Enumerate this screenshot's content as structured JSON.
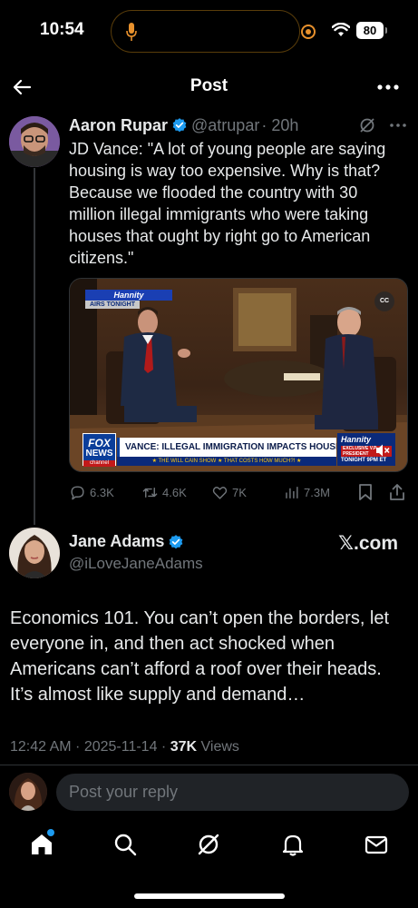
{
  "status_bar": {
    "time": "10:54",
    "battery": "80"
  },
  "header": {
    "title": "Post"
  },
  "quoted_post": {
    "author_name": "Aaron Rupar",
    "handle": "@atrupar",
    "age": "· 20h",
    "text": "JD Vance: \"A lot of young people are saying housing is way too expensive. Why is that? Because we flooded the country with 30 million illegal immigrants who were taking houses that ought by right go to American citizens.\"",
    "video": {
      "show_badge": "Hannity",
      "airs_badge": "AIRS TONIGHT",
      "cc_label": "CC",
      "network_line1": "FOX",
      "network_line2": "NEWS",
      "network_line3": "channel",
      "chyron": "VANCE: ILLEGAL IMMIGRATION IMPACTS HOUSING MARKET",
      "ticker": "★ THE WILL CAIN SHOW ★ THAT COSTS HOW MUCH?! ★",
      "promo_title": "Hannity",
      "promo_tag": "EXCLUSIVE V.P. PRESIDENT",
      "promo_time": "TONIGHT 9PM ET"
    },
    "stats": {
      "replies": "6.3K",
      "reposts": "4.6K",
      "likes": "7K",
      "views": "7.3M"
    }
  },
  "post": {
    "author_name": "Jane Adams",
    "handle": "@iLoveJaneAdams",
    "source": "𝕏.com",
    "text": "Economics 101. You can’t open the borders, let everyone in, and then act shocked when Americans can’t afford a roof over their heads. It’s almost like supply and demand…",
    "time": "12:42 AM · 2025-11-14 · ",
    "views_count": "37K",
    "views_label": " Views"
  },
  "reply": {
    "placeholder": "Post your reply"
  },
  "tabs": [
    "home",
    "search",
    "grok",
    "notifications",
    "messages"
  ],
  "colors": {
    "accent": "#1d9bf0",
    "background": "#000000",
    "text_primary": "#e7e9ea",
    "text_secondary": "#71767b",
    "island_border": "#5a3d0a",
    "camera_indicator": "#e8912d"
  }
}
